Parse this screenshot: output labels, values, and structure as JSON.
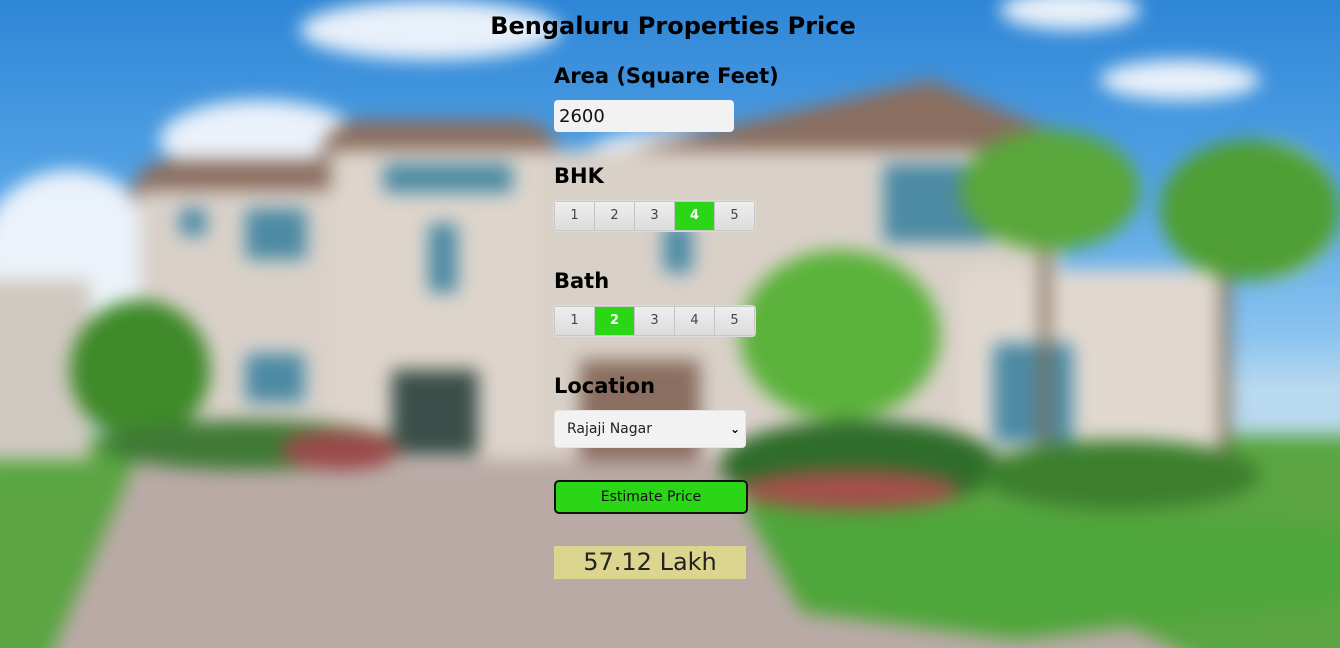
{
  "page": {
    "title": "Bengaluru Properties Price"
  },
  "area": {
    "label": "Area (Square Feet)",
    "value": "2600"
  },
  "bhk": {
    "label": "BHK",
    "options": [
      "1",
      "2",
      "3",
      "4",
      "5"
    ],
    "selected": "4"
  },
  "bath": {
    "label": "Bath",
    "options": [
      "1",
      "2",
      "3",
      "4",
      "5"
    ],
    "selected": "2"
  },
  "location": {
    "label": "Location",
    "selected": "Rajaji Nagar"
  },
  "estimate": {
    "button_label": "Estimate Price",
    "result": "57.12 Lakh"
  },
  "colors": {
    "accent": "#2bd617",
    "result_bg": "#dcd58f",
    "input_bg": "#f2f2f2"
  },
  "icons": {
    "select_arrow": "chevron-down-icon"
  }
}
